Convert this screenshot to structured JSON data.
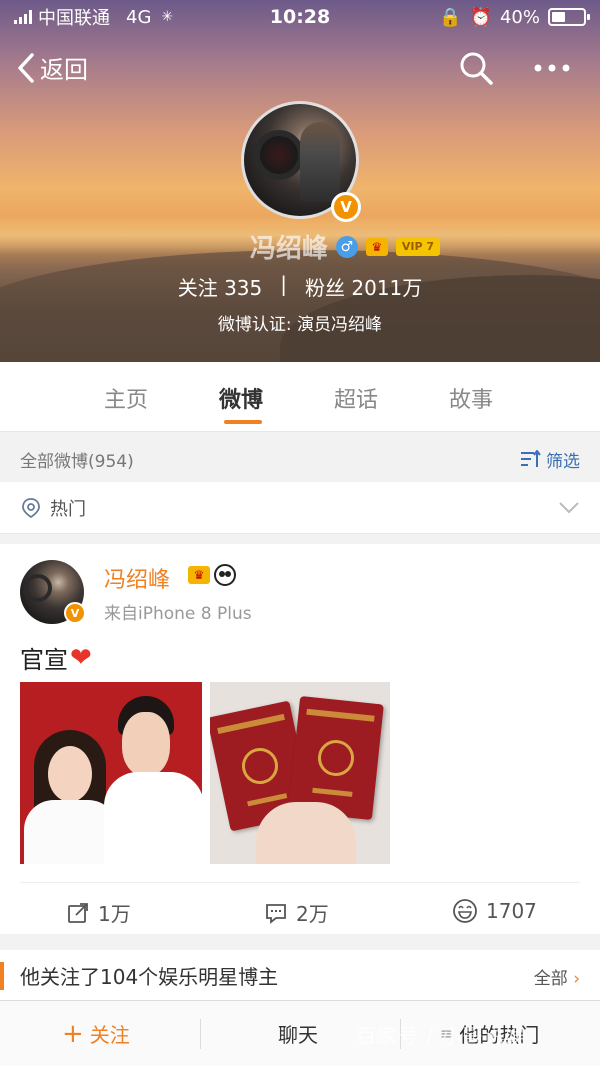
{
  "status_bar": {
    "carrier": "中国联通",
    "network": "4G",
    "time": "10:28",
    "battery": "40%"
  },
  "nav": {
    "back_label": "返回"
  },
  "profile": {
    "name": "冯绍峰",
    "vip": "VIP 7",
    "following_label": "关注",
    "following_count": "335",
    "divider": "|",
    "followers_label": "粉丝",
    "followers_count": "2011万",
    "verification": "微博认证: 演员冯绍峰",
    "verified_badge": "V"
  },
  "tabs": [
    "主页",
    "微博",
    "超话",
    "故事"
  ],
  "active_tab": "微博",
  "filter_bar": {
    "all_posts": "全部微博(954)",
    "filter_label": "筛选"
  },
  "hot_bar": {
    "label": "热门"
  },
  "post": {
    "author": "冯绍峰",
    "source": "来自iPhone 8 Plus",
    "text": "官宣",
    "heart": "❤",
    "reposts": "1万",
    "comments": "2万",
    "likes": "1707"
  },
  "follow_banner": {
    "text": "他关注了104个娱乐明星博主",
    "all_label": "全部",
    "arrow": "›"
  },
  "bottom_bar": {
    "follow_plus": "+",
    "follow_label": "关注",
    "chat_label": "聊天",
    "hot_label": "他的热门"
  },
  "watermark": "百家号 / 小哥说娱"
}
